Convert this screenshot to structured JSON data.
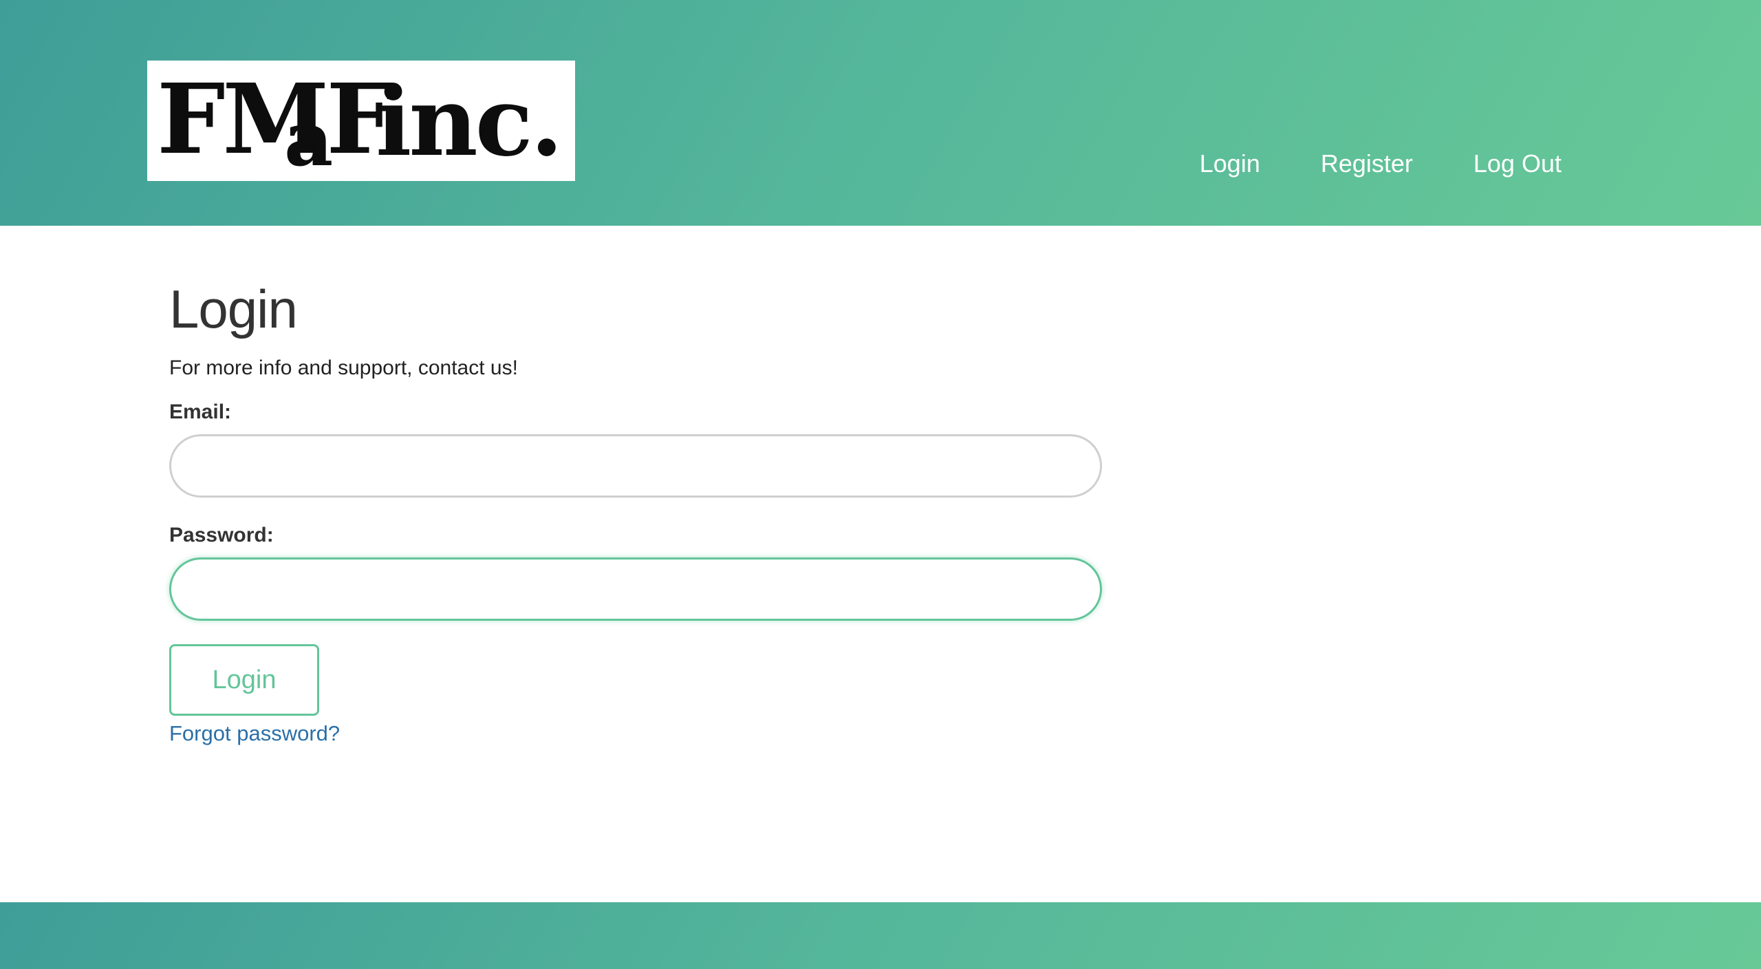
{
  "header": {
    "logo": {
      "text_main": "FMFa inc.",
      "part1": "FMF",
      "part2": "a",
      "part3": "inc."
    },
    "nav": [
      {
        "label": "Login"
      },
      {
        "label": "Register"
      },
      {
        "label": "Log Out"
      }
    ]
  },
  "main": {
    "title": "Login",
    "subtitle": "For more info and support, contact us!",
    "email": {
      "label": "Email:",
      "value": "",
      "placeholder": ""
    },
    "password": {
      "label": "Password:",
      "value": "",
      "placeholder": ""
    },
    "login_button": "Login",
    "forgot_link": "Forgot password?"
  },
  "colors": {
    "header_gradient_start": "#3f9e98",
    "header_gradient_end": "#68c997",
    "accent": "#63c59a",
    "link": "#2a6fa8",
    "text": "#333333"
  }
}
